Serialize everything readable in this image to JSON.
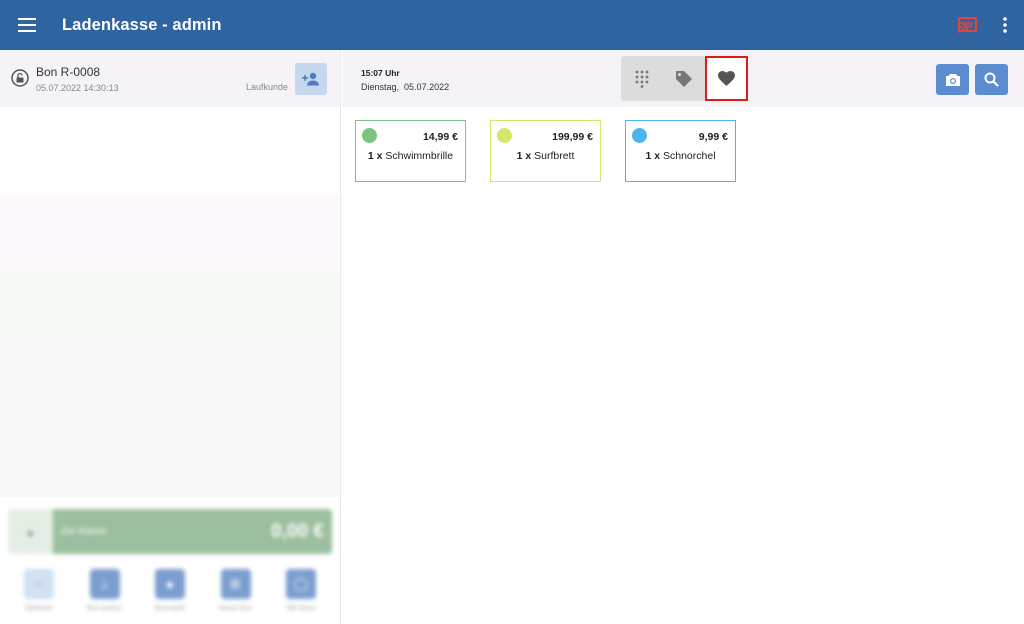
{
  "header": {
    "title": "Ladenkasse - admin",
    "icons": {
      "menu": "menu-icon",
      "cast": "cast-icon",
      "more": "more-vert-icon"
    },
    "colors": {
      "bar": "#2f64a0",
      "cast": "#e0463c"
    }
  },
  "receipt": {
    "title": "Bon R-0008",
    "datetime": "05.07.2022 14:30:13",
    "customer": "Laufkunde"
  },
  "payment": {
    "label": "Zur Kasse",
    "amount": "0,00 €"
  },
  "tools": [
    {
      "label": "Optionen",
      "icon": "options-icon"
    },
    {
      "label": "Bon parken",
      "icon": "park-icon"
    },
    {
      "label": "Bonrabatt",
      "icon": "discount-icon"
    },
    {
      "label": "Neuer Bon",
      "icon": "new-receipt-icon"
    },
    {
      "label": "Alle Bons",
      "icon": "all-receipts-icon"
    }
  ],
  "clock": {
    "time": "15:07 Uhr",
    "day": "Dienstag,",
    "date": "05.07.2022"
  },
  "modes": [
    {
      "icon": "keypad-icon",
      "active": false
    },
    {
      "icon": "tag-icon",
      "active": false
    },
    {
      "icon": "heart-icon",
      "active": true
    }
  ],
  "favorites": [
    {
      "qty": "1 x",
      "name": "Schwimmbrille",
      "price": "14,99 €",
      "color": "#7cc47f"
    },
    {
      "qty": "1 x",
      "name": "Surfbrett",
      "price": "199,99 €",
      "color": "#d8e46a"
    },
    {
      "qty": "1 x",
      "name": "Schnorchel",
      "price": "9,99 €",
      "color": "#4fb4ec"
    }
  ]
}
